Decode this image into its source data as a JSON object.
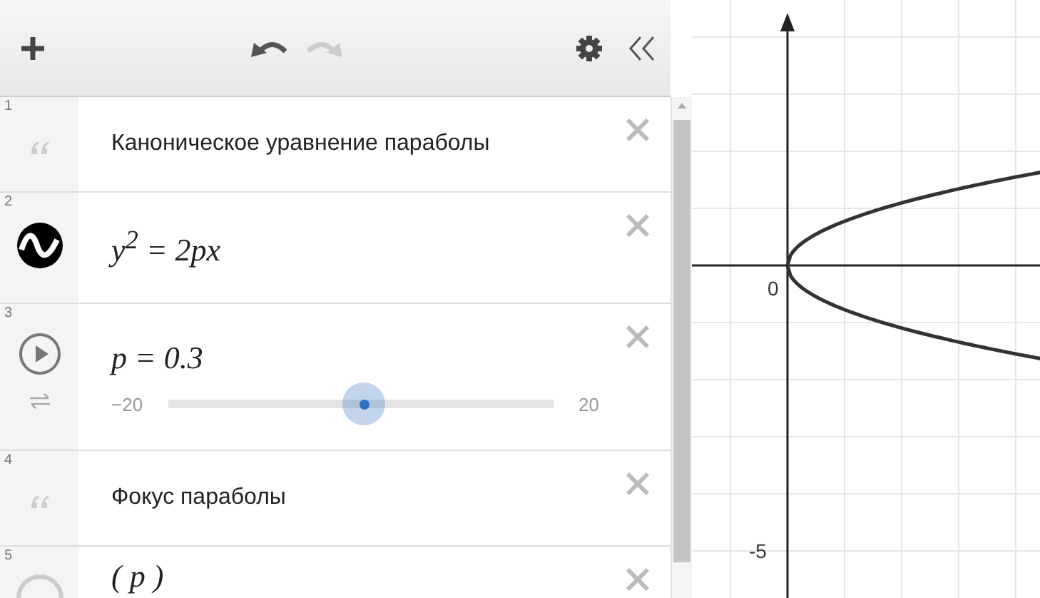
{
  "toolbar": {
    "undo_disabled": false,
    "redo_disabled": true
  },
  "expressions": [
    {
      "number": "1",
      "kind": "note",
      "text": "Каноническое уравнение параболы"
    },
    {
      "number": "2",
      "kind": "expression",
      "latex": "y$^{2}$ = 2px"
    },
    {
      "number": "3",
      "kind": "slider",
      "latex": "p = 0.3",
      "min": "−20",
      "max": "20",
      "level": 0.51
    },
    {
      "number": "4",
      "kind": "note",
      "text": "Фокус параболы"
    },
    {
      "number": "5",
      "kind": "point",
      "latex": "( p )"
    }
  ],
  "graph": {
    "origin_label": "0",
    "y_tick_labels": [
      "-5"
    ]
  }
}
